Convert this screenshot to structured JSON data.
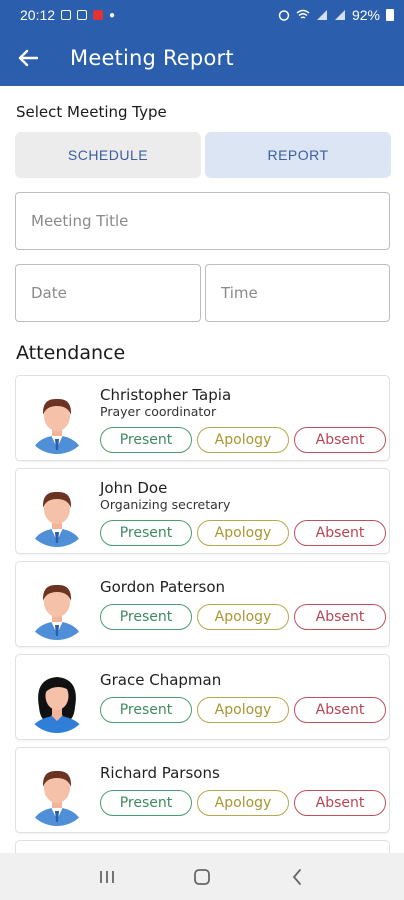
{
  "status": {
    "time": "20:12",
    "battery": "92%"
  },
  "app_bar": {
    "title": "Meeting Report",
    "back_icon": "arrow-left-icon"
  },
  "meeting_type": {
    "label": "Select Meeting Type",
    "schedule": "SCHEDULE",
    "report": "REPORT",
    "selected": "REPORT"
  },
  "form": {
    "title_placeholder": "Meeting Title",
    "date_placeholder": "Date",
    "time_placeholder": "Time"
  },
  "attendance": {
    "heading": "Attendance",
    "buttons": {
      "present": "Present",
      "apology": "Apology",
      "absent": "Absent"
    },
    "members": [
      {
        "name": "Christopher Tapia",
        "role": "Prayer coordinator",
        "avatar": "male"
      },
      {
        "name": "John Doe",
        "role": "Organizing secretary",
        "avatar": "male"
      },
      {
        "name": "Gordon Paterson",
        "role": "",
        "avatar": "male"
      },
      {
        "name": "Grace Chapman",
        "role": "",
        "avatar": "female"
      },
      {
        "name": "Richard Parsons",
        "role": "",
        "avatar": "male"
      }
    ]
  },
  "colors": {
    "primary": "#2b5fae",
    "present": "#4d9c70",
    "apology": "#b9a74c",
    "absent": "#c0505e"
  }
}
